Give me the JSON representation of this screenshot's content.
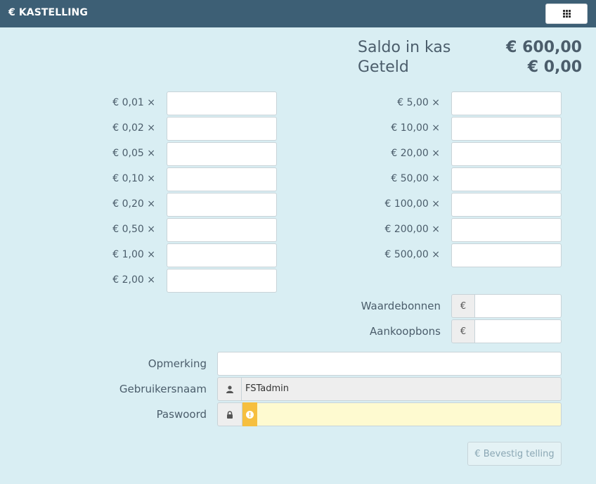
{
  "header": {
    "title": "€ KASTELLING",
    "apps_icon": "grid-icon"
  },
  "summary": {
    "saldo_label": "Saldo in kas",
    "saldo_value": "€ 600,00",
    "geteld_label": "Geteld",
    "geteld_value": "€ 0,00"
  },
  "coins_left": [
    "€ 0,01 ×",
    "€ 0,02 ×",
    "€ 0,05 ×",
    "€ 0,10 ×",
    "€ 0,20 ×",
    "€ 0,50 ×",
    "€ 1,00 ×",
    "€ 2,00 ×"
  ],
  "coins_right": [
    "€ 5,00 ×",
    "€ 10,00 ×",
    "€ 20,00 ×",
    "€ 50,00 ×",
    "€ 100,00 ×",
    "€ 200,00 ×",
    "€ 500,00 ×"
  ],
  "vouchers": {
    "waardebonnen_label": "Waardebonnen",
    "aankoopbons_label": "Aankoopbons",
    "currency_symbol": "€"
  },
  "form": {
    "opmerking_label": "Opmerking",
    "gebruikersnaam_label": "Gebruikersnaam",
    "gebruikersnaam_value": "FSTadmin",
    "user_icon": "user-icon",
    "paswoord_label": "Paswoord",
    "lock_icon": "lock-icon",
    "warning_icon": "warning-icon"
  },
  "actions": {
    "confirm_label": "€ Bevestig telling"
  },
  "colors": {
    "header_bg": "#3d5f75",
    "page_bg": "#d9eef3",
    "warning": "#f6bf3f",
    "password_bg": "#fefad0"
  }
}
